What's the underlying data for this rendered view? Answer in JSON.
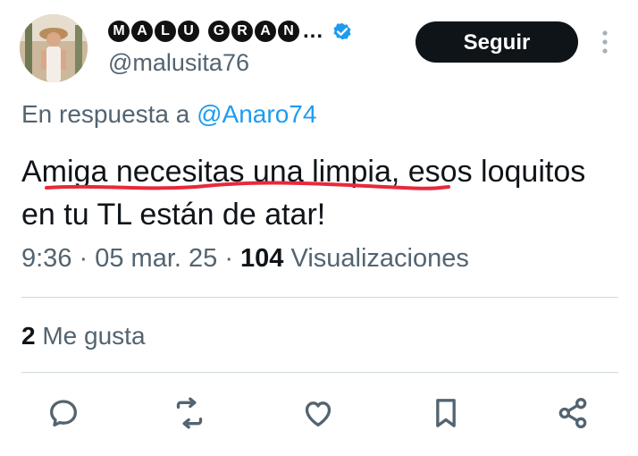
{
  "user": {
    "name_letters": [
      "M",
      "A",
      "L",
      "U",
      "G",
      "R",
      "A",
      "N"
    ],
    "name_ellipsis": "...",
    "handle": "@malusita76",
    "verified": true
  },
  "follow_button": {
    "label": "Seguir"
  },
  "reply": {
    "prefix": "En respuesta a",
    "mention": "@Anaro74"
  },
  "tweet": {
    "text": "Amiga necesitas una limpia, esos loquitos en tu TL están de atar!"
  },
  "meta": {
    "time": "9:36",
    "date": "05 mar. 25",
    "views_count": "104",
    "views_label": "Visualizaciones"
  },
  "likes": {
    "count": "2",
    "label": "Me gusta"
  },
  "actions": [
    "reply-icon",
    "retweet-icon",
    "like-icon",
    "bookmark-icon",
    "share-icon"
  ],
  "colors": {
    "text": "#0f1419",
    "secondary": "#536471",
    "link": "#1d9bf0",
    "verified": "#1d9bf0",
    "underline_annotation": "#e8293b",
    "divider": "#cfd9de"
  }
}
